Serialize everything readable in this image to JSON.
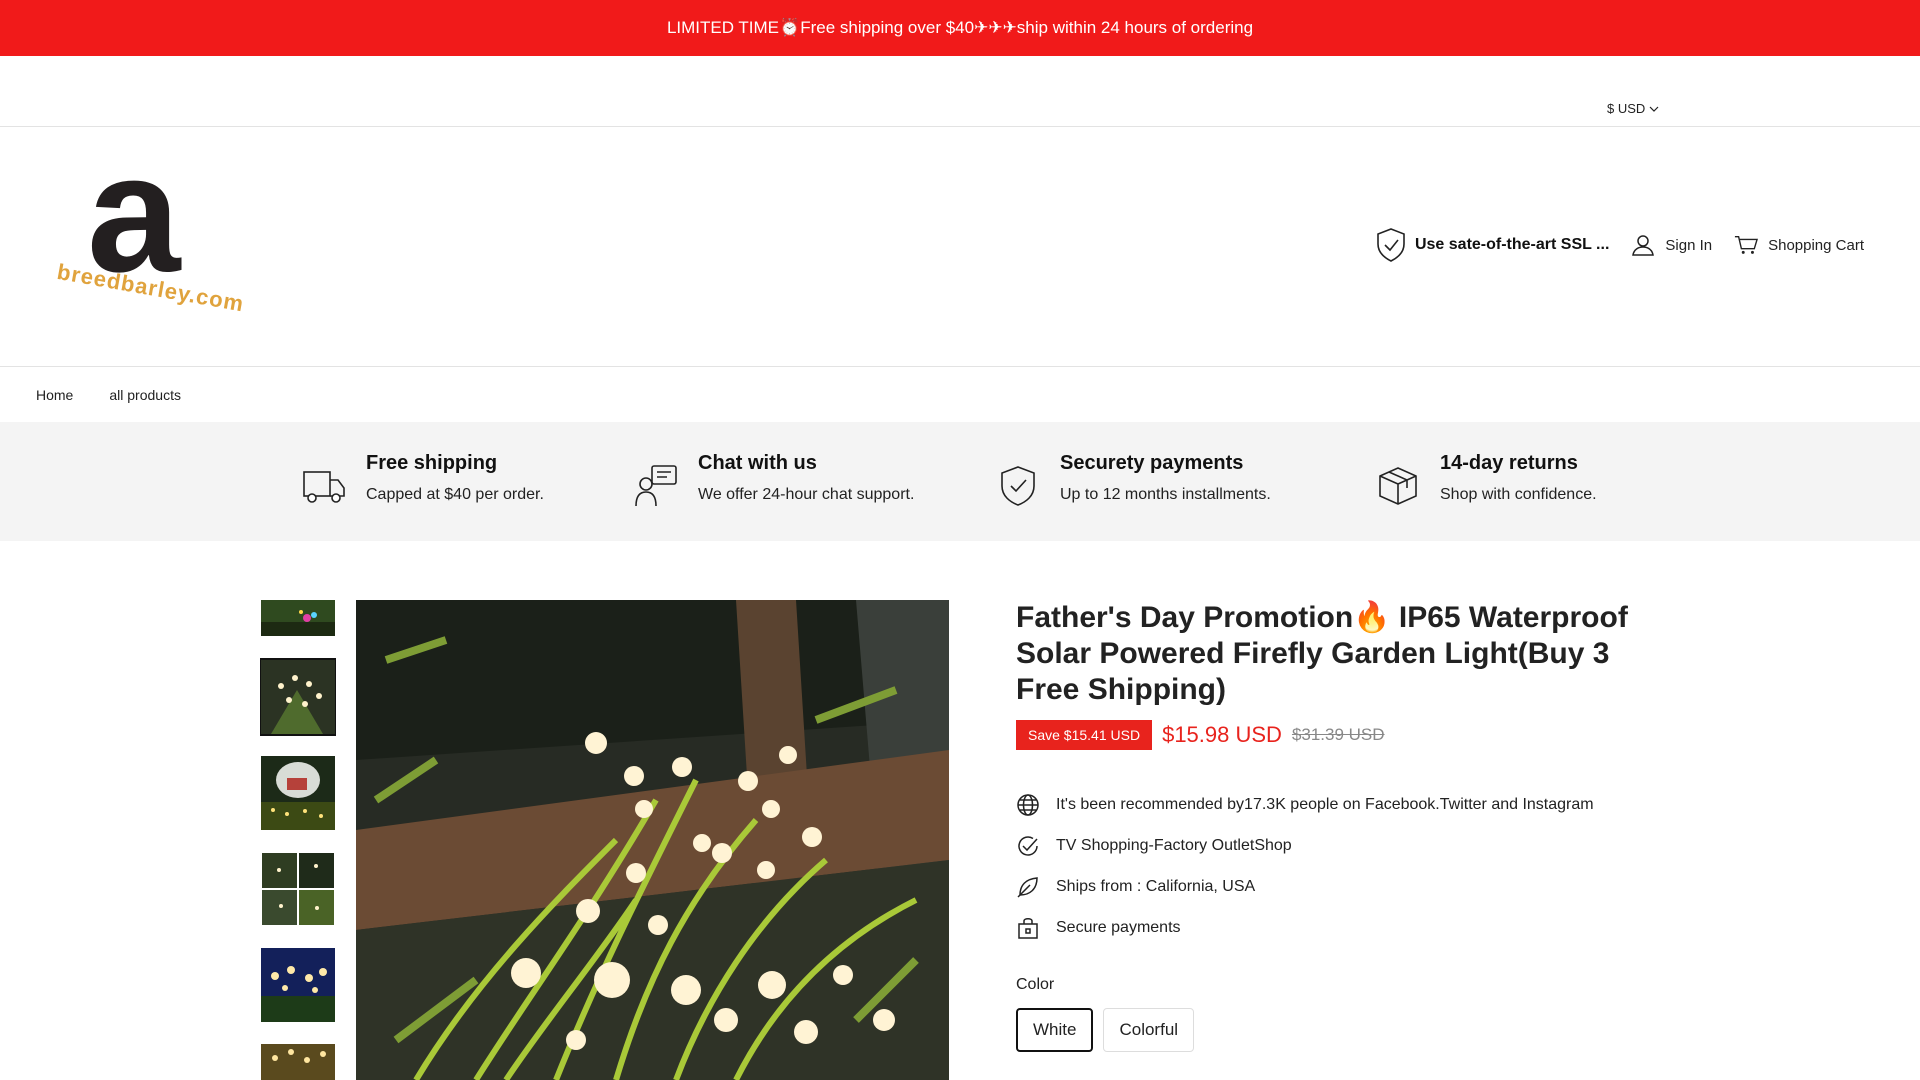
{
  "announcement": {
    "text": "LIMITED TIME⏰Free shipping over $40✈✈✈ship within 24 hours of ordering"
  },
  "utility": {
    "currency": "$ USD"
  },
  "header": {
    "logo_letter": "a",
    "logo_text": "breedbarley.com",
    "ssl_text": "Use sate-of-the-art SSL ...",
    "sign_in": "Sign In",
    "cart": "Shopping Cart"
  },
  "nav": {
    "items": [
      {
        "label": "Home"
      },
      {
        "label": "all products"
      }
    ]
  },
  "features": [
    {
      "icon": "truck-icon",
      "title": "Free shipping",
      "desc": "Capped at $40 per order."
    },
    {
      "icon": "support-chat-icon",
      "title": "Chat with us",
      "desc": "We offer 24-hour chat support."
    },
    {
      "icon": "shield-check-icon",
      "title": "Securety payments",
      "desc": "Up to 12 months installments."
    },
    {
      "icon": "box-icon",
      "title": "14-day returns",
      "desc": "Shop with confidence."
    }
  ],
  "product": {
    "title": "Father's Day Promotion🔥 IP65 Waterproof Solar Powered Firefly Garden Light(Buy 3 Free Shipping)",
    "save_badge": "Save $15.41 USD",
    "price": "$15.98 USD",
    "compare_price": "$31.39 USD",
    "bullets": [
      {
        "icon": "globe-icon",
        "text": "It's been recommended by17.3K people on Facebook.Twitter and Instagram"
      },
      {
        "icon": "check-circle-icon",
        "text": "TV Shopping-Factory OutletShop"
      },
      {
        "icon": "leaf-icon",
        "text": "Ships from : California, USA"
      },
      {
        "icon": "lock-bag-icon",
        "text": "Secure payments"
      }
    ],
    "color_label": "Color",
    "colors": [
      {
        "label": "White",
        "selected": true
      },
      {
        "label": "Colorful",
        "selected": false
      }
    ]
  },
  "colors": {
    "announcement_bg": "#f11a1a",
    "sale_red": "#e8231d",
    "logo_orange": "#e0a33d",
    "features_bg": "#f4f4f4"
  }
}
